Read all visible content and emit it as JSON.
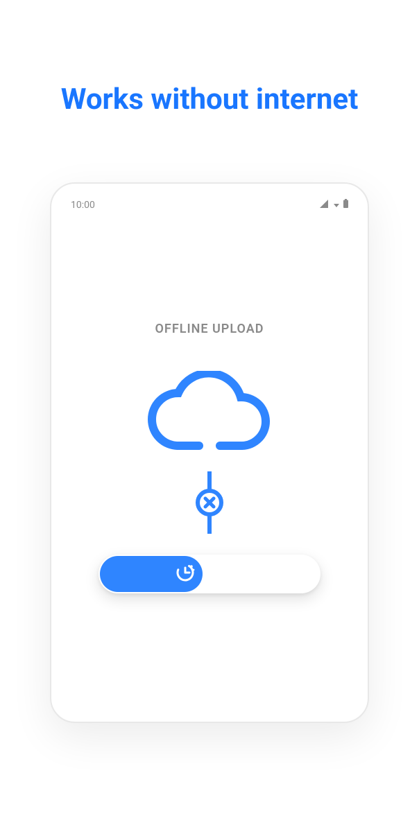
{
  "header": {
    "title": "Works without internet"
  },
  "status_bar": {
    "time": "10:00"
  },
  "screen": {
    "section_label": "OFFLINE UPLOAD"
  },
  "colors": {
    "primary": "#2f85ff",
    "muted": "#8a8a8a"
  }
}
